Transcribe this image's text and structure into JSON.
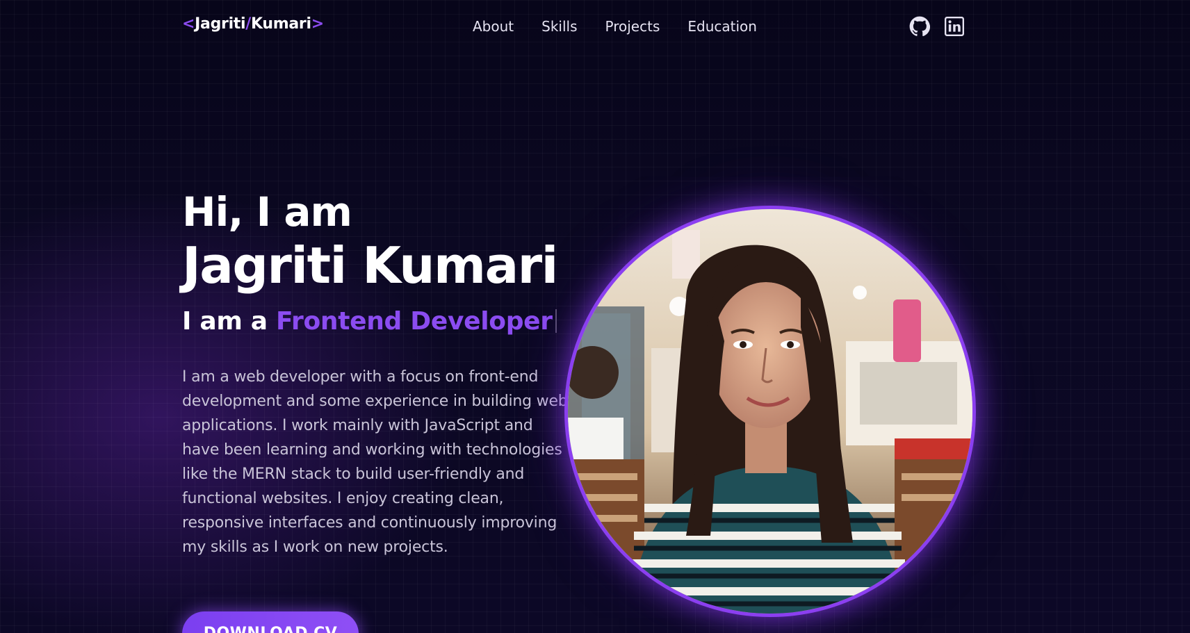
{
  "nav": {
    "logo": {
      "open_bracket": "<",
      "first": "Jagriti",
      "slash": "/",
      "last": "Kumari",
      "close_bracket": ">"
    },
    "links": [
      {
        "label": "About"
      },
      {
        "label": "Skills"
      },
      {
        "label": "Projects"
      },
      {
        "label": "Education"
      }
    ],
    "social": [
      {
        "icon": "github-icon"
      },
      {
        "icon": "linkedin-icon"
      }
    ]
  },
  "hero": {
    "greeting": "Hi, I am",
    "name": "Jagriti Kumari",
    "role_prefix": "I am a ",
    "role": "Frontend Developer",
    "description": "I am a web developer with a focus on front-end development and some experience in building web applications. I work mainly with JavaScript and have been learning and working with technologies like the MERN stack to build user-friendly and functional websites. I enjoy creating clean, responsive interfaces and continuously improving my skills as I work on new projects.",
    "cv_button": "DOWNLOAD CV",
    "photo_alt": "Profile photo"
  },
  "colors": {
    "accent": "#8b4cf0",
    "background": "#07051a",
    "text": "#ffffff",
    "muted_text": "#c9c4d8"
  }
}
